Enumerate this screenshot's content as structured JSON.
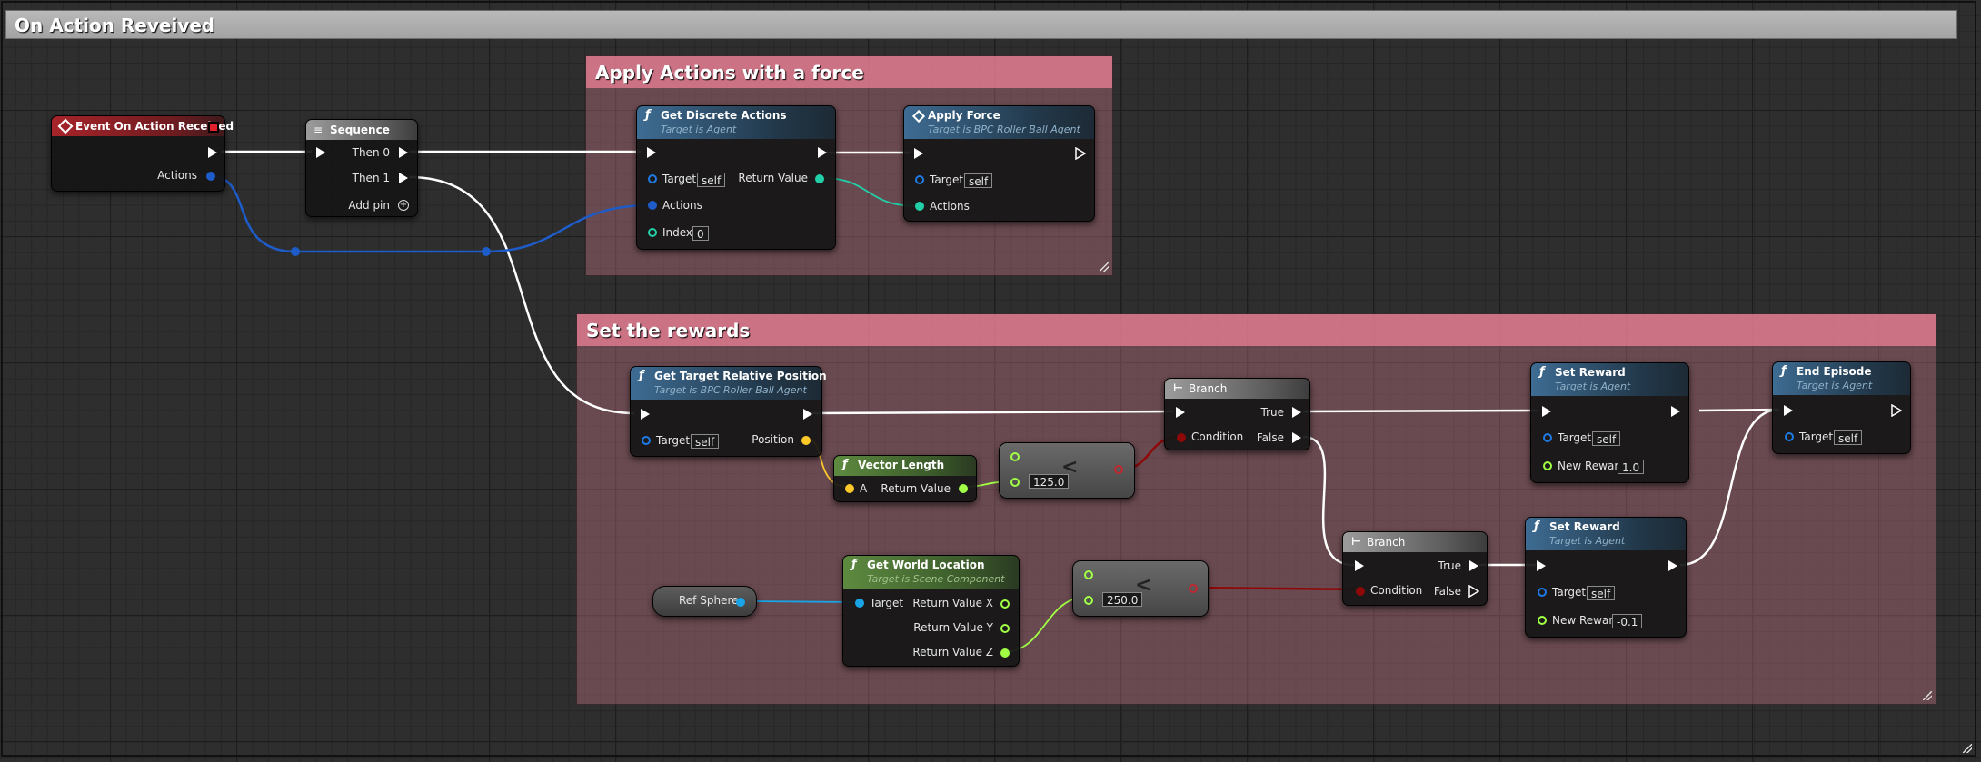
{
  "graph": {
    "title": "On Action Reveived"
  },
  "comments": {
    "apply": "Apply Actions with a force",
    "rewards": "Set the rewards"
  },
  "colors": {
    "exec": "#ffffff",
    "object": "#1e7be6",
    "float": "#a1ff45",
    "vector": "#fdc929",
    "bool": "#8e0808",
    "actions_struct": "#1e5cc9",
    "teal": "#22cfa8",
    "reference": "#1aa3e6"
  },
  "nodes": {
    "event": {
      "title": "Event On Action Received",
      "pin_actions": "Actions",
      "icon": "event-icon"
    },
    "sequence": {
      "title": "Sequence",
      "then0": "Then 0",
      "then1": "Then 1",
      "add_pin": "Add pin",
      "icon": "sequence-icon"
    },
    "get_discrete": {
      "title": "Get Discrete Actions",
      "subtitle": "Target is Agent",
      "target": "Target",
      "target_val": "self",
      "return": "Return Value",
      "actions": "Actions",
      "index": "Index",
      "index_val": "0",
      "icon": "function-icon"
    },
    "apply_force": {
      "title": "Apply Force",
      "subtitle": "Target is BPC Roller Ball Agent",
      "target": "Target",
      "target_val": "self",
      "actions": "Actions",
      "icon": "function-diamond-icon"
    },
    "get_target_rel": {
      "title": "Get Target Relative Position",
      "subtitle": "Target is BPC Roller Ball Agent",
      "target": "Target",
      "target_val": "self",
      "position": "Position",
      "icon": "function-icon"
    },
    "vector_length": {
      "title": "Vector Length",
      "a": "A",
      "return": "Return Value",
      "icon": "function-icon"
    },
    "compare1": {
      "value": "125.0",
      "symbol": "<"
    },
    "branch1": {
      "title": "Branch",
      "condition": "Condition",
      "true": "True",
      "false": "False",
      "icon": "branch-icon"
    },
    "set_reward1": {
      "title": "Set Reward",
      "subtitle": "Target is Agent",
      "target": "Target",
      "target_val": "self",
      "new_reward": "New Reward",
      "new_reward_val": "1.0",
      "icon": "function-icon"
    },
    "end_episode": {
      "title": "End Episode",
      "subtitle": "Target is Agent",
      "target": "Target",
      "target_val": "self",
      "icon": "function-icon"
    },
    "ref_sphere": {
      "label": "Ref Sphere"
    },
    "get_world_loc": {
      "title": "Get World Location",
      "subtitle": "Target is Scene Component",
      "target": "Target",
      "rx": "Return Value X",
      "ry": "Return Value Y",
      "rz": "Return Value Z",
      "icon": "function-icon"
    },
    "compare2": {
      "value": "250.0",
      "symbol": "<"
    },
    "branch2": {
      "title": "Branch",
      "condition": "Condition",
      "true": "True",
      "false": "False",
      "icon": "branch-icon"
    },
    "set_reward2": {
      "title": "Set Reward",
      "subtitle": "Target is Agent",
      "target": "Target",
      "target_val": "self",
      "new_reward": "New Reward",
      "new_reward_val": "-0.1",
      "icon": "function-icon"
    }
  }
}
